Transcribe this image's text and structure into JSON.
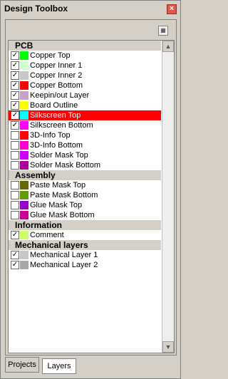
{
  "window": {
    "title": "Design Toolbox",
    "close_glyph": "×"
  },
  "toolbar": {
    "icon": "layers-options-icon"
  },
  "sections": [
    {
      "title": "PCB",
      "layers": [
        {
          "label": "Copper Top",
          "checked": true,
          "color": "#00ff00"
        },
        {
          "label": "Copper Inner 1",
          "checked": true,
          "color": "#ccffcc"
        },
        {
          "label": "Copper Inner 2",
          "checked": true,
          "color": "#c8c8c8"
        },
        {
          "label": "Copper Bottom",
          "checked": true,
          "color": "#ff0000"
        },
        {
          "label": "Keepin/out Layer",
          "checked": true,
          "color": "#c8a0c8"
        },
        {
          "label": "Board Outline",
          "checked": true,
          "color": "#ffff00"
        },
        {
          "label": "Silkscreen Top",
          "checked": true,
          "color": "#00ffff",
          "selected": true
        },
        {
          "label": "Silkscreen Bottom",
          "checked": true,
          "color": "#ff00ff"
        },
        {
          "label": "3D-Info Top",
          "checked": false,
          "color": "#ff0000"
        },
        {
          "label": "3D-Info Bottom",
          "checked": false,
          "color": "#ff00cc"
        },
        {
          "label": "Solder Mask Top",
          "checked": false,
          "color": "#cc00ff"
        },
        {
          "label": "Solder Mask Bottom",
          "checked": false,
          "color": "#aa0099"
        }
      ]
    },
    {
      "title": "Assembly",
      "layers": [
        {
          "label": "Paste Mask Top",
          "checked": false,
          "color": "#666600"
        },
        {
          "label": "Paste Mask Bottom",
          "checked": false,
          "color": "#669900"
        },
        {
          "label": "Glue Mask Top",
          "checked": false,
          "color": "#9900cc"
        },
        {
          "label": "Glue Mask Bottom",
          "checked": false,
          "color": "#cc0099"
        }
      ]
    },
    {
      "title": "Information",
      "layers": [
        {
          "label": "Comment",
          "checked": true,
          "color": "#ccff66"
        }
      ]
    },
    {
      "title": "Mechanical layers",
      "layers": [
        {
          "label": "Mechanical Layer 1",
          "checked": true,
          "color": "#c8c8c8"
        },
        {
          "label": "Mechanical Layer 2",
          "checked": true,
          "color": "#a8a8a8"
        }
      ]
    }
  ],
  "tabs": [
    {
      "label": "Projects",
      "active": false
    },
    {
      "label": "Layers",
      "active": true
    }
  ]
}
